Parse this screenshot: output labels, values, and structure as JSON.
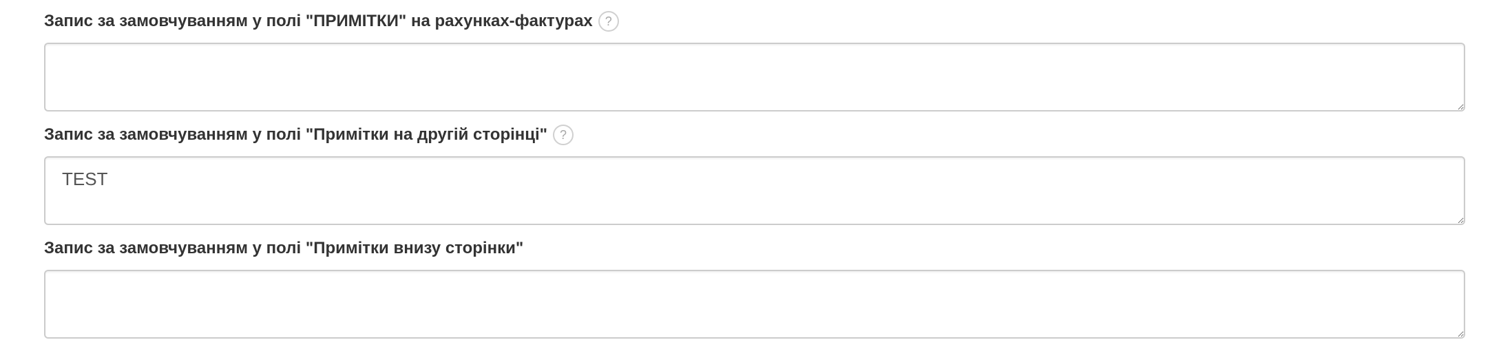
{
  "fields": [
    {
      "label": "Запис за замовчуванням у полі \"ПРИМІТКИ\" на рахунках-фактурах",
      "help": "?",
      "value": ""
    },
    {
      "label": "Запис за замовчуванням у полі \"Примітки на другій сторінці\"",
      "help": "?",
      "value": "TEST"
    },
    {
      "label": "Запис за замовчуванням у полі \"Примітки внизу сторінки\"",
      "value": ""
    }
  ],
  "icons": {
    "help": "question-circle-icon"
  }
}
